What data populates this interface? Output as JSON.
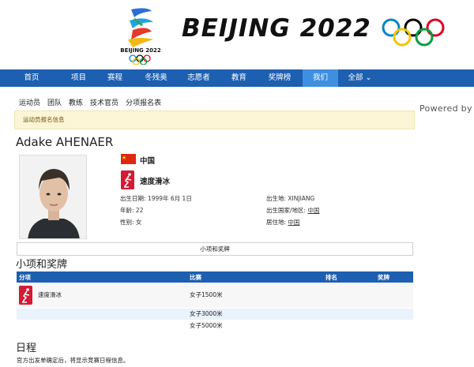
{
  "banner": {
    "emblem_text": "BEIJING 2022",
    "wordmark": "BEIJING 2022"
  },
  "nav": {
    "items": [
      {
        "label": "首页"
      },
      {
        "label": "项目"
      },
      {
        "label": "赛程"
      },
      {
        "label": "冬残奥"
      },
      {
        "label": "志愿者"
      },
      {
        "label": "教育"
      },
      {
        "label": "奖牌榜"
      },
      {
        "label": "我们"
      },
      {
        "label": "全部 ⌄"
      }
    ]
  },
  "subnav": [
    "运动员",
    "团队",
    "教练",
    "技术官员",
    "分项报名表"
  ],
  "powered_by": "Powered by",
  "notice": "运动员报名信息",
  "athlete": {
    "name": "Adake AHENAER",
    "country": "中国",
    "sport": "速度滑冰",
    "birth_date_label": "出生日期:",
    "birth_date": "1999年 6月 1日",
    "age_label": "年龄:",
    "age": "22",
    "gender_label": "性别:",
    "gender": "女",
    "birthplace_label": "出生地:",
    "birthplace": "XINJIANG",
    "birth_country_label": "出生国家/地区:",
    "birth_country": "中国",
    "residence_label": "居住地:",
    "residence": "中国"
  },
  "tab": "小项和奖牌",
  "events_section": {
    "title": "小项和奖牌",
    "headers": [
      "分项",
      "比赛",
      "排名",
      "奖牌"
    ],
    "discipline": "速度滑冰",
    "rows": [
      "女子1500米",
      "女子3000米",
      "女子5000米"
    ]
  },
  "schedule": {
    "title": "日程",
    "note": "官方出发单确定后，将显示竞赛日程信息。"
  },
  "colors": {
    "nav_blue": "#1d5fb0",
    "nav_active": "#3f8fe0",
    "speed_skating_red": "#d31b35",
    "notice_bg": "#fbf5d6"
  }
}
